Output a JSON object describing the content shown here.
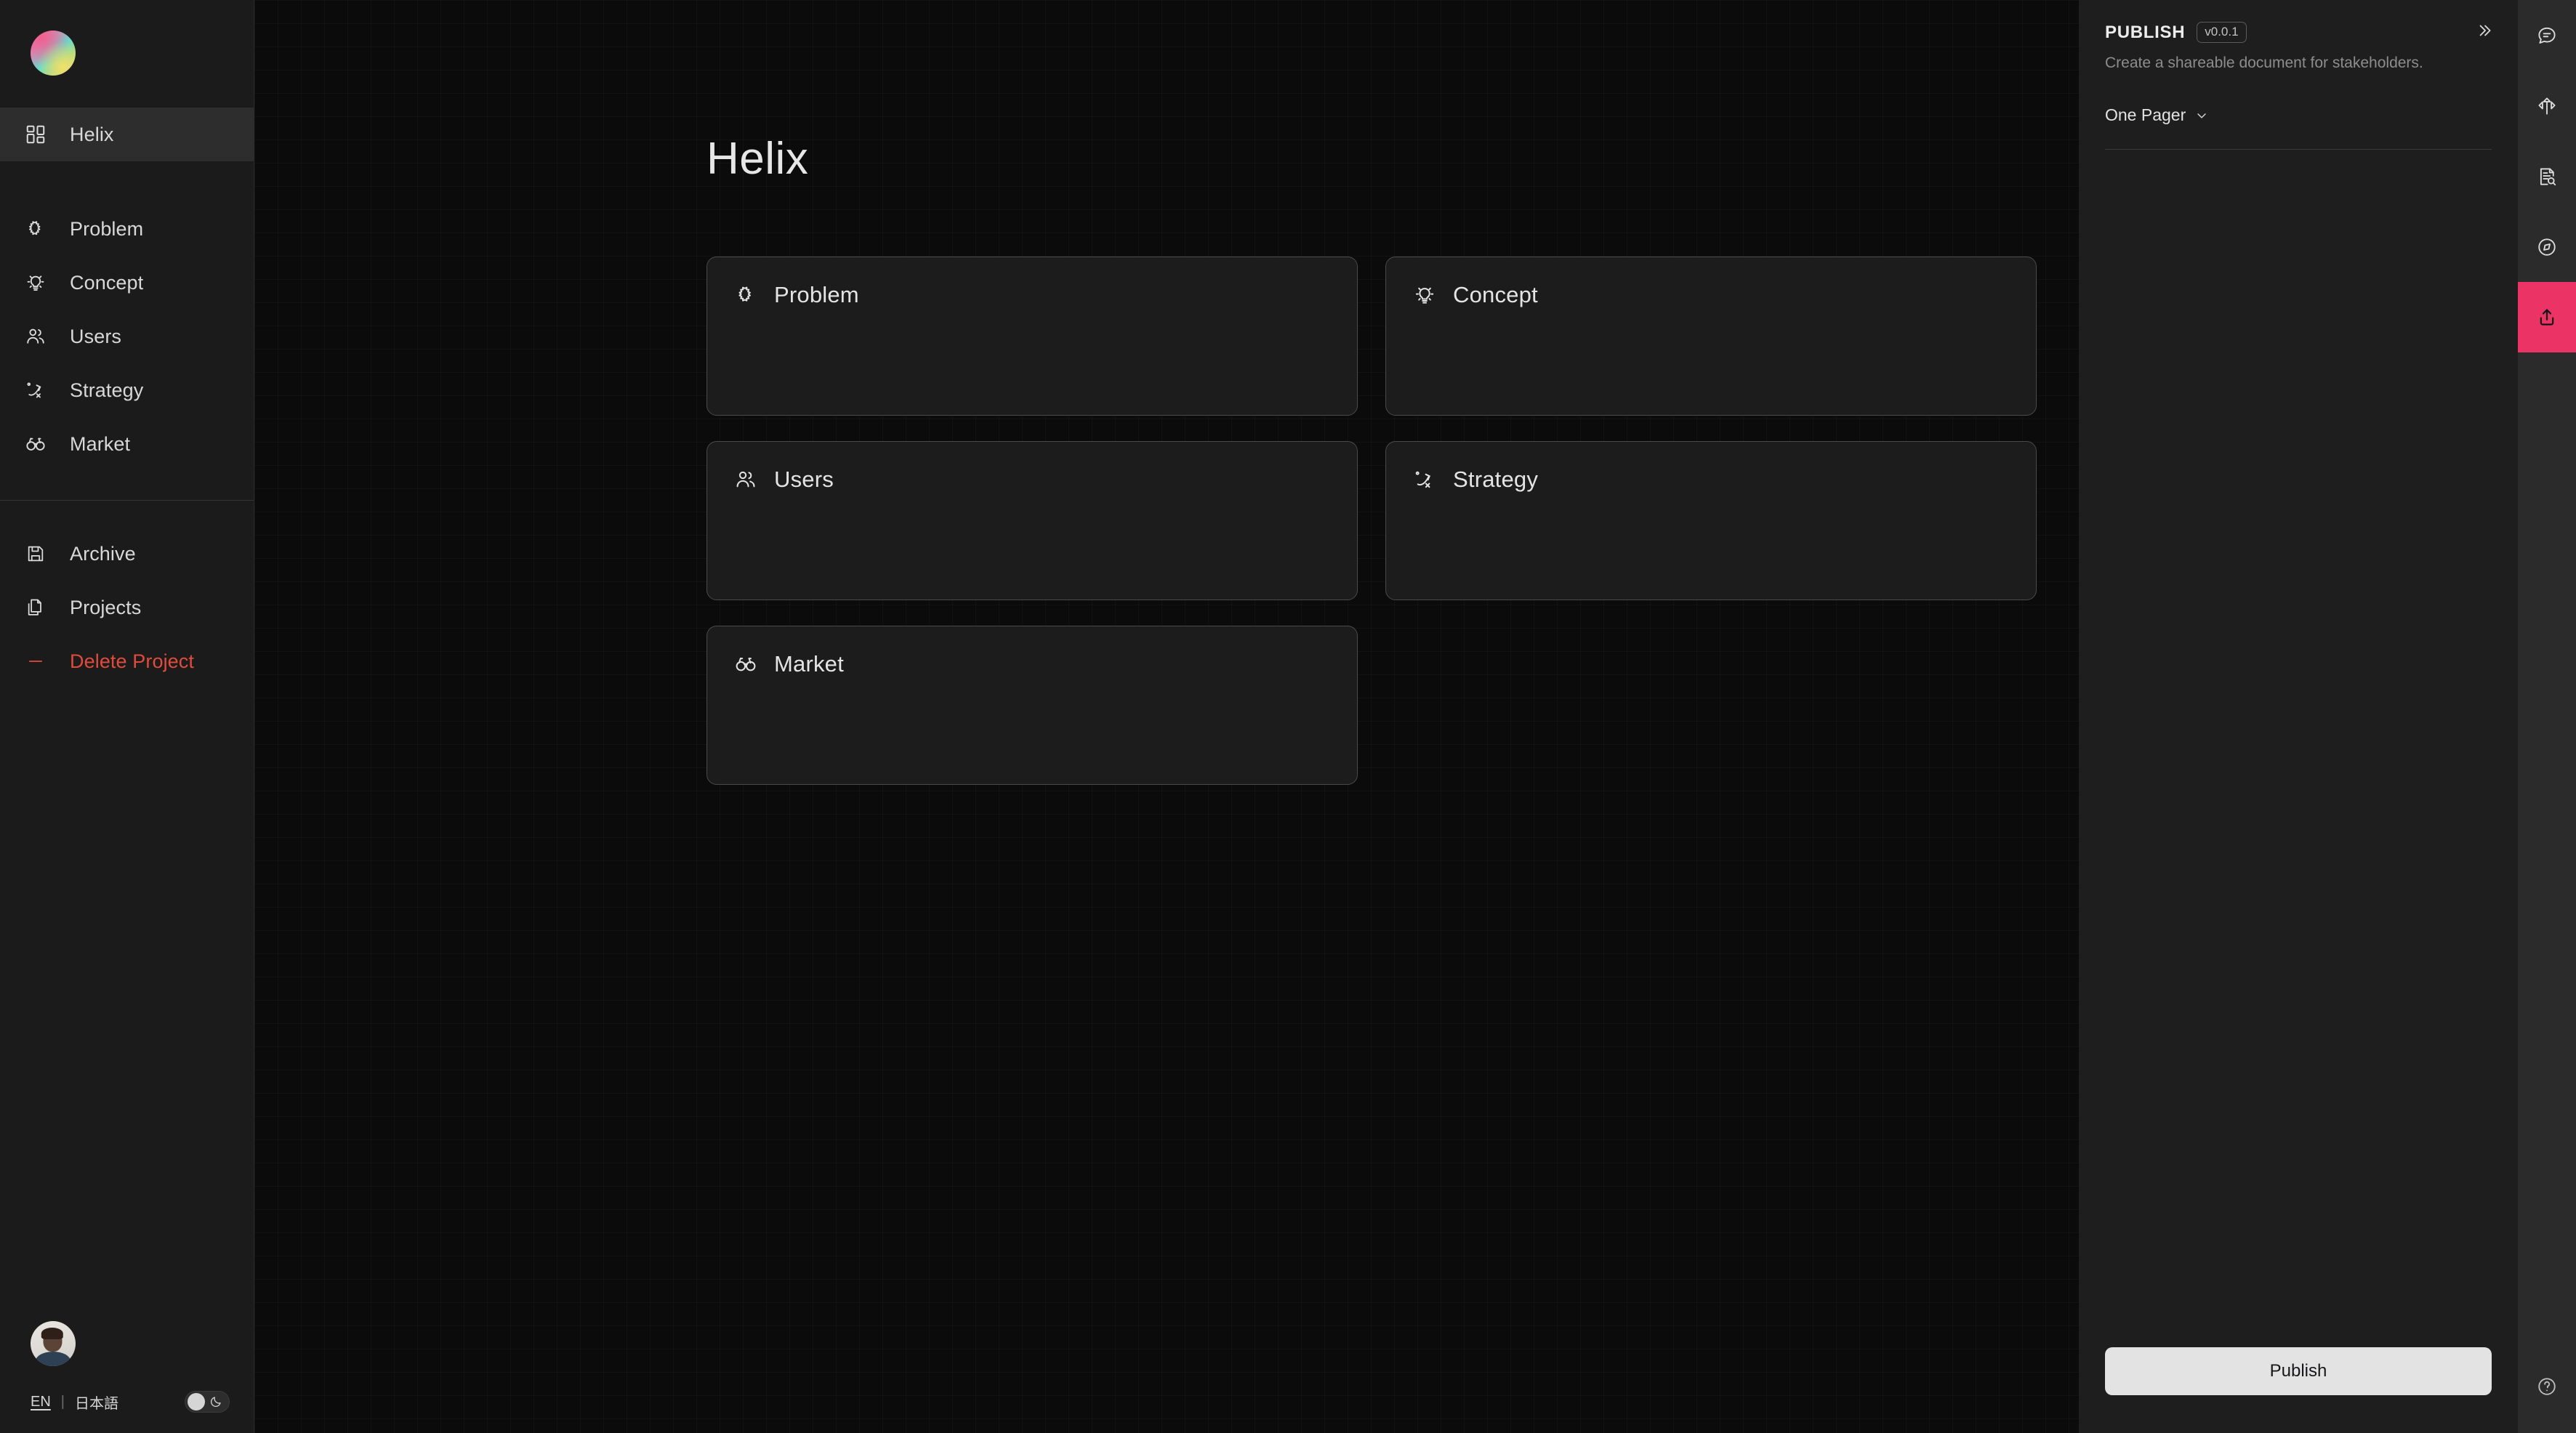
{
  "brand": {
    "logo_name": "app-logo"
  },
  "sidebar": {
    "primary": [
      {
        "label": "Helix",
        "icon": "dashboard-icon",
        "active": true
      },
      {
        "label": "Problem",
        "icon": "puzzle-icon",
        "active": false
      },
      {
        "label": "Concept",
        "icon": "lightbulb-icon",
        "active": false
      },
      {
        "label": "Users",
        "icon": "users-icon",
        "active": false
      },
      {
        "label": "Strategy",
        "icon": "strategy-icon",
        "active": false
      },
      {
        "label": "Market",
        "icon": "binoculars-icon",
        "active": false
      }
    ],
    "secondary": [
      {
        "label": "Archive",
        "icon": "save-icon",
        "danger": false
      },
      {
        "label": "Projects",
        "icon": "files-icon",
        "danger": false
      },
      {
        "label": "Delete Project",
        "icon": "minus-icon",
        "danger": true
      }
    ],
    "footer": {
      "avatar_name": "user-avatar",
      "lang_en": "EN",
      "lang_sep": "|",
      "lang_ja": "日本語",
      "theme_icon": "moon-icon"
    }
  },
  "main": {
    "title": "Helix",
    "cards": [
      {
        "label": "Problem",
        "icon": "puzzle-icon"
      },
      {
        "label": "Concept",
        "icon": "lightbulb-icon"
      },
      {
        "label": "Users",
        "icon": "users-icon"
      },
      {
        "label": "Strategy",
        "icon": "strategy-icon"
      },
      {
        "label": "Market",
        "icon": "binoculars-icon"
      }
    ]
  },
  "publish_panel": {
    "title": "PUBLISH",
    "version": "v0.0.1",
    "subtitle": "Create a shareable document for stakeholders.",
    "format_select": "One Pager",
    "collapse_icon": "chevron-double-right-icon",
    "publish_button": "Publish"
  },
  "rail": {
    "items": [
      {
        "icon": "comment-icon",
        "active": false
      },
      {
        "icon": "move-arrows-icon",
        "active": false
      },
      {
        "icon": "document-search-icon",
        "active": false
      },
      {
        "icon": "compass-icon",
        "active": false
      },
      {
        "icon": "upload-icon",
        "active": true
      }
    ],
    "help_icon": "help-circle-icon"
  },
  "colors": {
    "accent_pink": "#ec3366",
    "danger_red": "#e14b3b",
    "sidebar_bg": "#1b1b1b",
    "canvas_bg": "#0b0b0b",
    "panel_bg": "#1e1e1e",
    "rail_bg": "#2b2b2b",
    "card_bg": "#1c1c1c"
  }
}
